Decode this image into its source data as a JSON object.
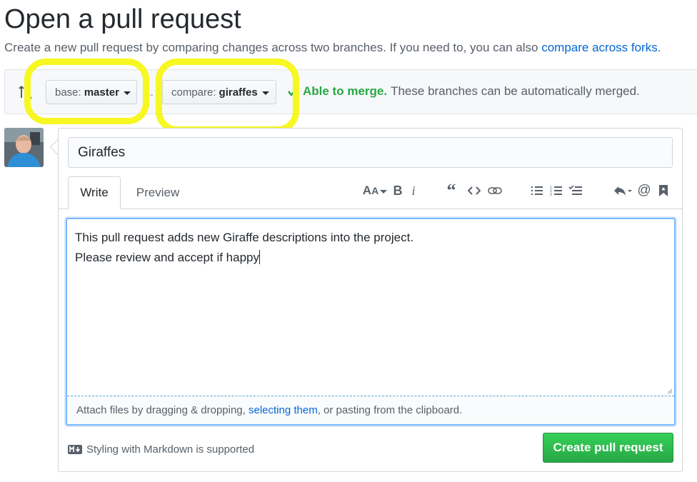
{
  "page": {
    "title": "Open a pull request",
    "subtitle_text": "Create a new pull request by comparing changes across two branches. If you need to, you can also ",
    "subtitle_link": "compare across forks",
    "subtitle_end": "."
  },
  "range": {
    "base_prefix": "base:",
    "base_value": "master",
    "separator": "...",
    "compare_prefix": "compare:",
    "compare_value": "giraffes",
    "merge_status": "Able to merge.",
    "merge_message": "These branches can be automatically merged.",
    "merge_color": "#28a745"
  },
  "form": {
    "title_value": "Giraffes",
    "tabs": [
      "Write",
      "Preview"
    ],
    "toolbar_icons": [
      "text-size-icon",
      "bold-icon",
      "italic-icon",
      "quote-icon",
      "code-icon",
      "link-icon",
      "bullet-list-icon",
      "numbered-list-icon",
      "task-list-icon",
      "reply-icon",
      "mention-icon",
      "bookmark-icon"
    ],
    "body_line1": "This pull request adds new Giraffe descriptions into the project.",
    "body_line2": "Please review and accept if happy",
    "attach_prefix": "Attach files by dragging & dropping, ",
    "attach_link": "selecting them",
    "attach_suffix": ", or pasting from the clipboard.",
    "markdown_note": "Styling with Markdown is supported",
    "submit_label": "Create pull request"
  },
  "colors": {
    "link": "#0366d6",
    "primary_button": "#28a745",
    "highlight": "#f7f722"
  }
}
